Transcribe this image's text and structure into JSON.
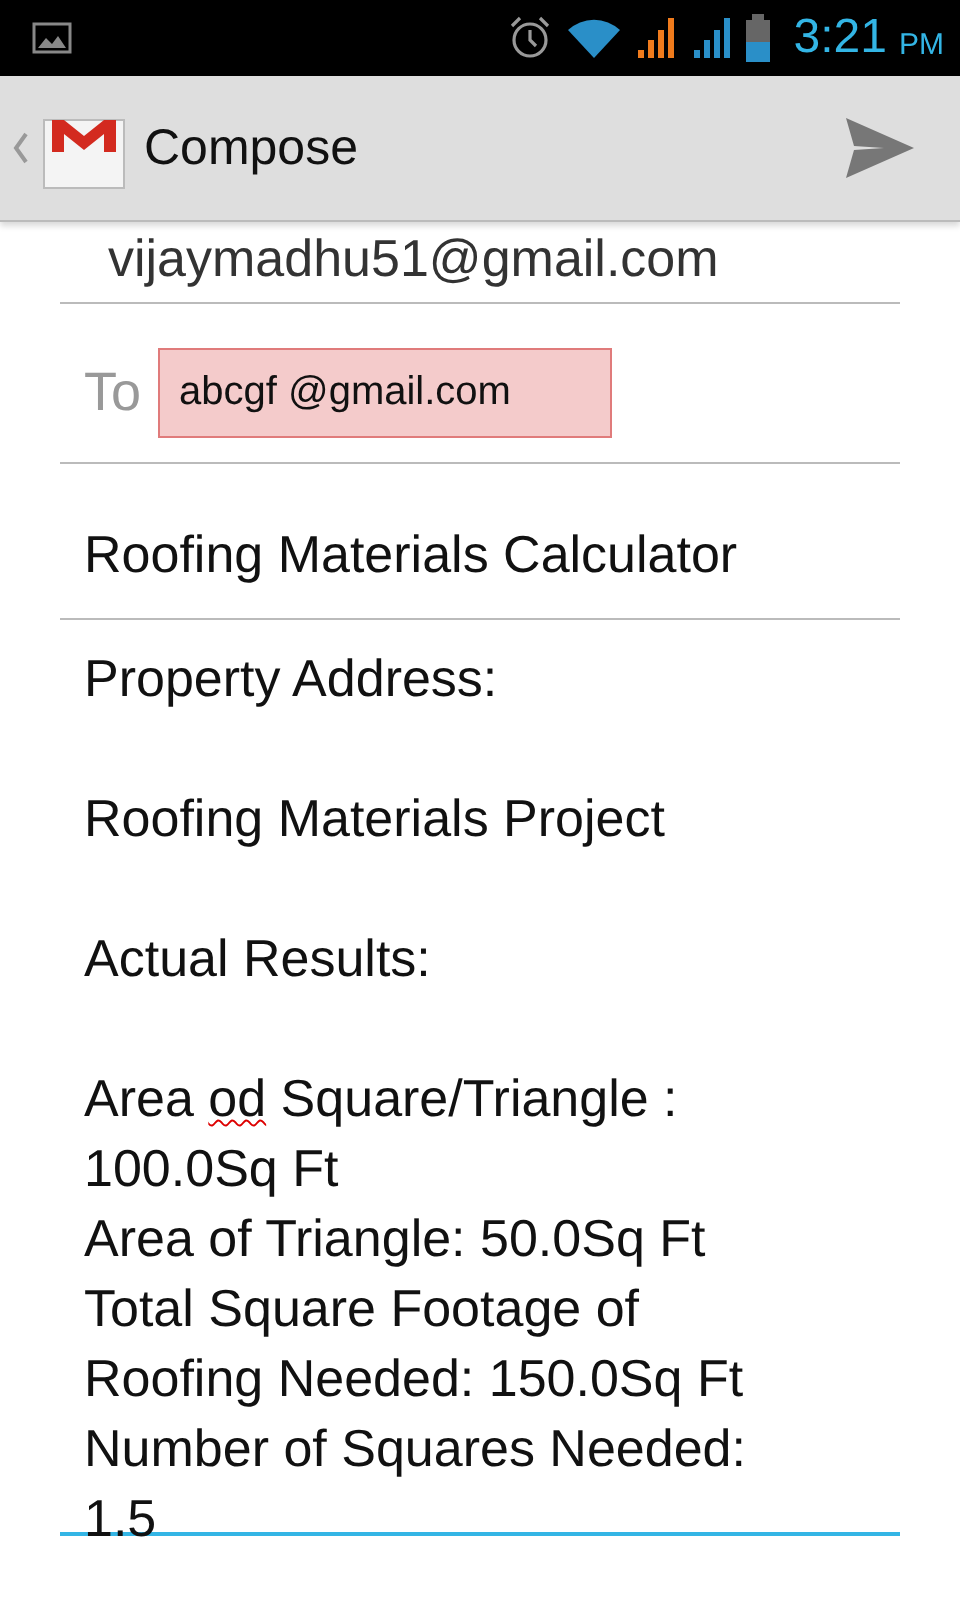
{
  "status_bar": {
    "time": "3:21",
    "ampm": "PM"
  },
  "action_bar": {
    "title": "Compose"
  },
  "from": {
    "value": "vijaymadhu51@gmail.com"
  },
  "to": {
    "label": "To",
    "recipients": [
      {
        "address": "abcgf @gmail.com"
      }
    ]
  },
  "subject": {
    "value": "Roofing Materials Calculator"
  },
  "body": {
    "focused": true,
    "paragraphs": [
      [
        {
          "text": "Property Address:",
          "misspelled": false
        }
      ],
      [
        {
          "text": "Roofing Materials Project",
          "misspelled": false
        }
      ],
      [
        {
          "text": "Actual Results:",
          "misspelled": false
        }
      ],
      [
        {
          "text": "Area ",
          "misspelled": false
        },
        {
          "text": "od",
          "misspelled": true
        },
        {
          "text": " Square/Triangle : 100.0Sq Ft",
          "misspelled": false
        }
      ],
      [
        {
          "text": "Area of Triangle: 50.0Sq Ft",
          "misspelled": false
        }
      ],
      [
        {
          "text": "Total Square Footage of Roofing Needed: 150.0Sq Ft",
          "misspelled": false
        }
      ],
      [
        {
          "text": "Number of Squares Needed: 1.5",
          "misspelled": false
        }
      ]
    ]
  }
}
